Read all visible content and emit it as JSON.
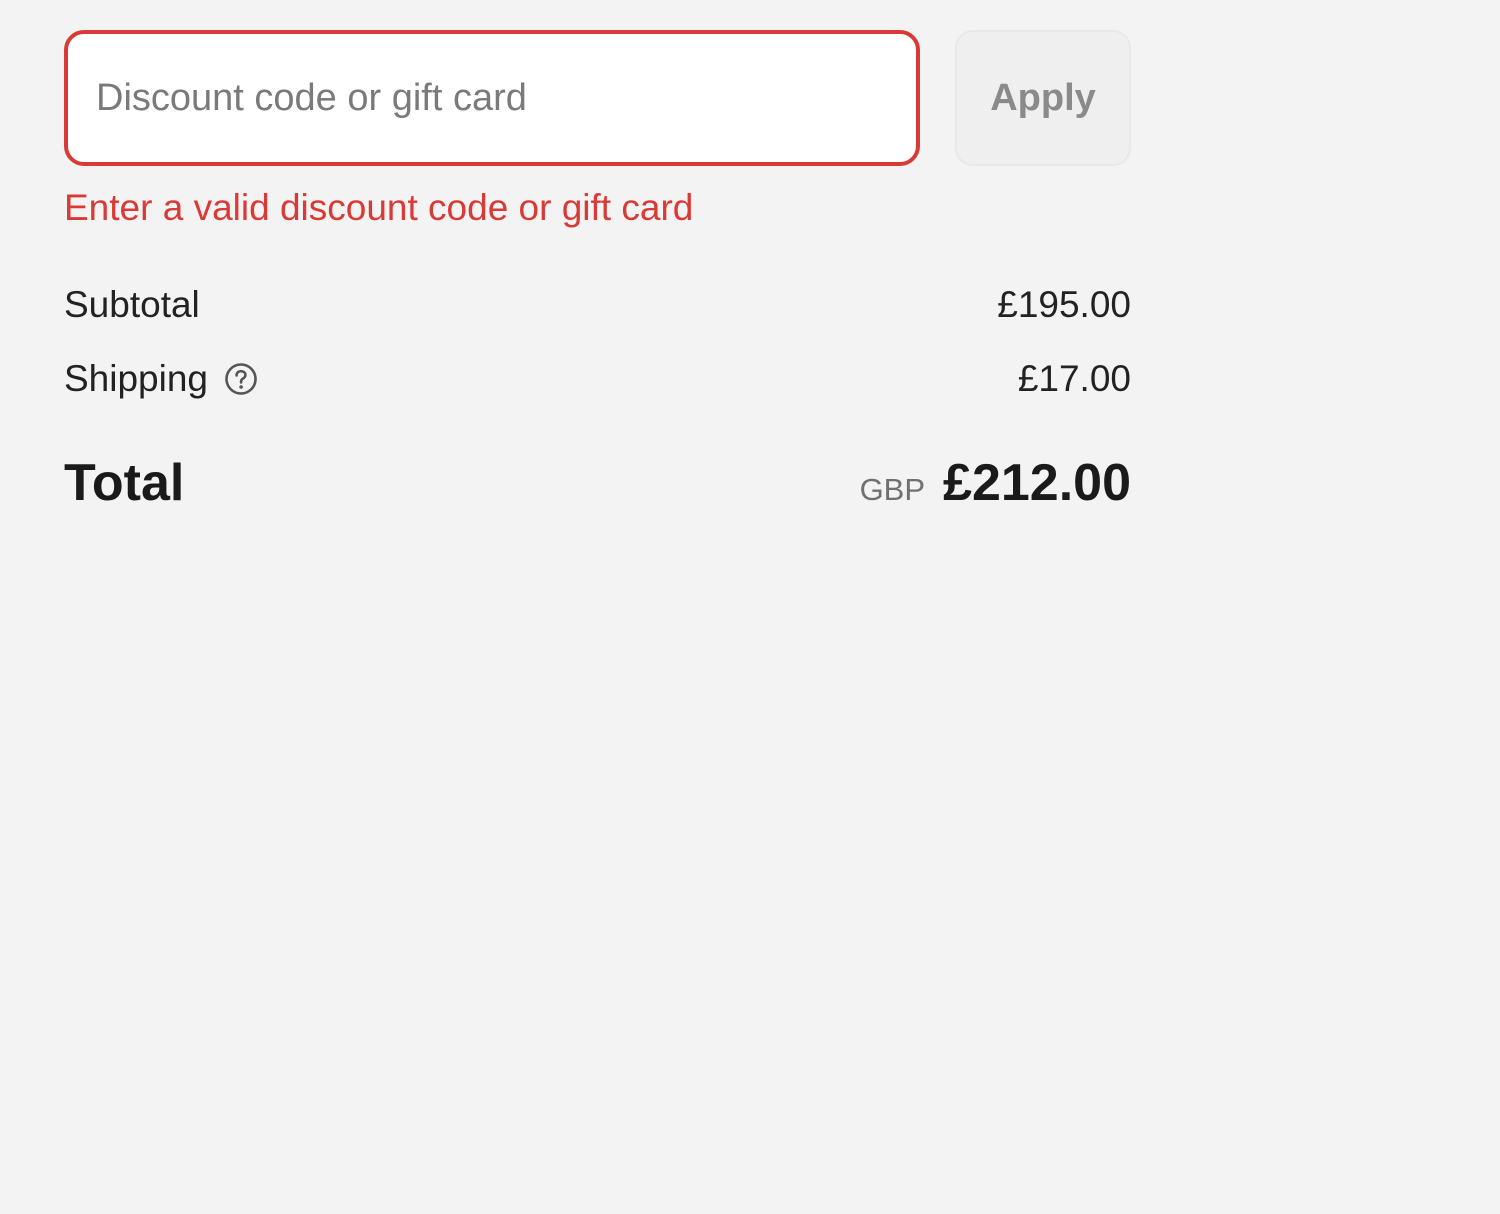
{
  "discount": {
    "placeholder": "Discount code or gift card",
    "value": "",
    "apply_label": "Apply",
    "error": "Enter a valid discount code or gift card",
    "error_color": "#d93a36"
  },
  "summary": {
    "subtotal_label": "Subtotal",
    "subtotal_value": "£195.00",
    "shipping_label": "Shipping",
    "shipping_help_icon": "question-circle-icon",
    "shipping_value": "£17.00",
    "total_label": "Total",
    "total_currency": "GBP",
    "total_value": "£212.00"
  }
}
